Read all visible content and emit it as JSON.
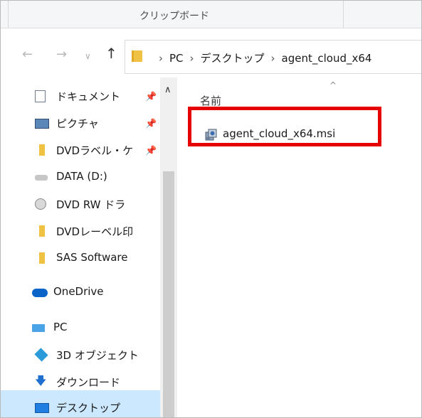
{
  "ribbon": {
    "group_label": "クリップボード"
  },
  "nav": {
    "back_icon": "arrow-left-icon",
    "forward_icon": "arrow-right-icon",
    "recent_icon": "chevron-down-icon",
    "up_icon": "arrow-up-icon"
  },
  "address": {
    "crumbs": [
      "PC",
      "デスクトップ",
      "agent_cloud_x64"
    ]
  },
  "navpane": {
    "items": [
      {
        "label": "ドキュメント",
        "icon": "document-icon",
        "pinned": true
      },
      {
        "label": "ピクチャ",
        "icon": "pictures-icon",
        "pinned": true
      },
      {
        "label": "DVDラベル・ケ",
        "icon": "folder-icon",
        "pinned": true
      },
      {
        "label": "DATA (D:)",
        "icon": "drive-icon",
        "pinned": false
      },
      {
        "label": "DVD RW ドラ",
        "icon": "dvd-drive-icon",
        "pinned": false
      },
      {
        "label": "DVDレーベル印",
        "icon": "folder-icon",
        "pinned": false
      },
      {
        "label": "SAS Software",
        "icon": "folder-icon",
        "pinned": false
      },
      {
        "label": "OneDrive",
        "icon": "onedrive-icon",
        "pinned": false
      },
      {
        "label": "PC",
        "icon": "pc-icon",
        "pinned": false
      },
      {
        "label": "3D オブジェクト",
        "icon": "3d-objects-icon",
        "pinned": false
      },
      {
        "label": "ダウンロード",
        "icon": "downloads-icon",
        "pinned": false
      },
      {
        "label": "デスクトップ",
        "icon": "desktop-icon",
        "pinned": false
      }
    ],
    "pin_glyph": "📌",
    "selected": "デスクトップ"
  },
  "content": {
    "column_header": "名前",
    "files": [
      {
        "name": "agent_cloud_x64.msi",
        "icon": "msi-installer-icon"
      }
    ]
  },
  "colors": {
    "highlight": "#e60000",
    "selection": "#cce8ff"
  }
}
